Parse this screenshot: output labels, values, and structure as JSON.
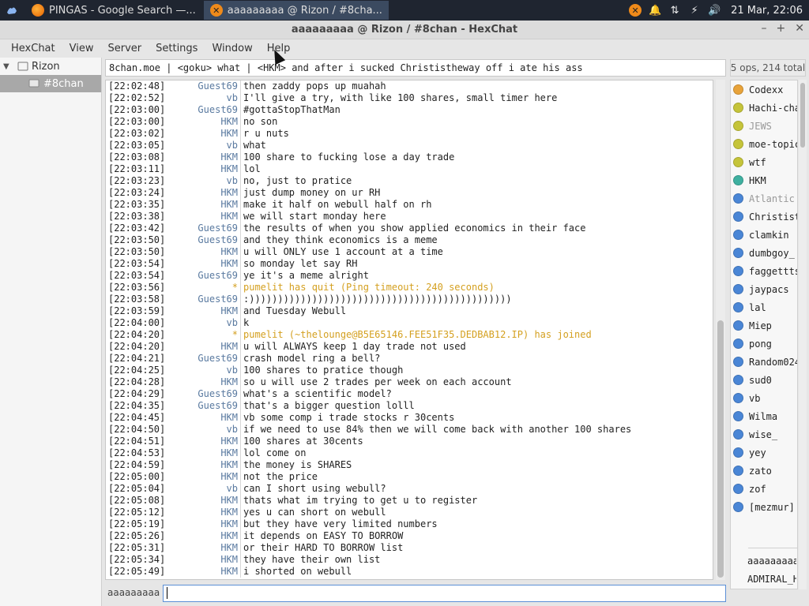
{
  "taskbar": {
    "tasks": [
      {
        "label": "PINGAS - Google Search —...",
        "icon": "firefox-icon",
        "color": "#e66000"
      },
      {
        "label": "aaaaaaaaa @ Rizon / #8cha...",
        "icon": "hexchat-icon",
        "color": "#ef8a1a"
      }
    ],
    "clock": "21 Mar, 22:06"
  },
  "window": {
    "title": "aaaaaaaaa @ Rizon / #8chan - HexChat",
    "controls": [
      "–",
      "+",
      "✕"
    ]
  },
  "menu": [
    "HexChat",
    "View",
    "Server",
    "Settings",
    "Window",
    "Help"
  ],
  "tree": {
    "server": "Rizon",
    "channel": "#8chan"
  },
  "topic": "8chan.moe | <goku> what | <HKM> and after i sucked Christistheway off i ate his ass",
  "ops_summary": "5 ops, 214 total",
  "messages": [
    {
      "ts": "[22:02:48]",
      "nick": "Guest69",
      "msg": "then zaddy pops up muahah"
    },
    {
      "ts": "[22:02:52]",
      "nick": "vb",
      "msg": "I'll give a try, with like 100 shares, small timer here"
    },
    {
      "ts": "[22:03:00]",
      "nick": "Guest69",
      "msg": "#gottaStopThatMan"
    },
    {
      "ts": "[22:03:00]",
      "nick": "HKM",
      "msg": "no son"
    },
    {
      "ts": "[22:03:02]",
      "nick": "HKM",
      "msg": "r u nuts"
    },
    {
      "ts": "[22:03:05]",
      "nick": "vb",
      "msg": "what"
    },
    {
      "ts": "[22:03:08]",
      "nick": "HKM",
      "msg": "100 share to fucking lose a day trade"
    },
    {
      "ts": "[22:03:11]",
      "nick": "HKM",
      "msg": "lol"
    },
    {
      "ts": "[22:03:23]",
      "nick": "vb",
      "msg": "no, just to pratice"
    },
    {
      "ts": "[22:03:24]",
      "nick": "HKM",
      "msg": "just dump money on ur RH"
    },
    {
      "ts": "[22:03:35]",
      "nick": "HKM",
      "msg": "make it half on webull half on rh"
    },
    {
      "ts": "[22:03:38]",
      "nick": "HKM",
      "msg": "we will start monday here"
    },
    {
      "ts": "[22:03:42]",
      "nick": "Guest69",
      "msg": "the results of when you show applied economics in their face"
    },
    {
      "ts": "[22:03:50]",
      "nick": "Guest69",
      "msg": "and they think economics is a meme"
    },
    {
      "ts": "[22:03:50]",
      "nick": "HKM",
      "msg": "u will ONLY use 1 account at a time"
    },
    {
      "ts": "[22:03:54]",
      "nick": "HKM",
      "msg": "so monday let say RH"
    },
    {
      "ts": "[22:03:54]",
      "nick": "Guest69",
      "msg": "ye it's a meme alright"
    },
    {
      "ts": "[22:03:56]",
      "nick": "*",
      "msg": "pumelit has quit (Ping timeout: 240 seconds)",
      "system": true
    },
    {
      "ts": "[22:03:58]",
      "nick": "Guest69",
      "msg": ":))))))))))))))))))))))))))))))))))))))))))))))"
    },
    {
      "ts": "[22:03:59]",
      "nick": "HKM",
      "msg": "and Tuesday Webull"
    },
    {
      "ts": "[22:04:00]",
      "nick": "vb",
      "msg": "k"
    },
    {
      "ts": "[22:04:20]",
      "nick": "*",
      "msg": "pumelit (~thelounge@B5E65146.FEE51F35.DEDBAB12.IP) has joined",
      "system": true
    },
    {
      "ts": "[22:04:20]",
      "nick": "HKM",
      "msg": "u will ALWAYS keep 1 day trade not used"
    },
    {
      "ts": "[22:04:21]",
      "nick": "Guest69",
      "msg": "crash model ring a bell?"
    },
    {
      "ts": "[22:04:25]",
      "nick": "vb",
      "msg": "100 shares to pratice though"
    },
    {
      "ts": "[22:04:28]",
      "nick": "HKM",
      "msg": "so u will use 2 trades per week on each account"
    },
    {
      "ts": "[22:04:29]",
      "nick": "Guest69",
      "msg": "what's a scientific model?"
    },
    {
      "ts": "[22:04:35]",
      "nick": "Guest69",
      "msg": "that's a bigger question lolll"
    },
    {
      "ts": "[22:04:45]",
      "nick": "HKM",
      "msg": "vb some comp i trade stocks r 30cents"
    },
    {
      "ts": "[22:04:50]",
      "nick": "vb",
      "msg": "if we need to use 84% then we will come back with another 100 shares"
    },
    {
      "ts": "[22:04:51]",
      "nick": "HKM",
      "msg": "100 shares at 30cents"
    },
    {
      "ts": "[22:04:53]",
      "nick": "HKM",
      "msg": "lol come on"
    },
    {
      "ts": "[22:04:59]",
      "nick": "HKM",
      "msg": "the money is SHARES"
    },
    {
      "ts": "[22:05:00]",
      "nick": "HKM",
      "msg": "not the price"
    },
    {
      "ts": "[22:05:04]",
      "nick": "vb",
      "msg": "can I short using webull?"
    },
    {
      "ts": "[22:05:08]",
      "nick": "HKM",
      "msg": "thats what im trying to get u to register"
    },
    {
      "ts": "[22:05:12]",
      "nick": "HKM",
      "msg": "yes u can short on webull"
    },
    {
      "ts": "[22:05:19]",
      "nick": "HKM",
      "msg": "but they have very limited numbers"
    },
    {
      "ts": "[22:05:26]",
      "nick": "HKM",
      "msg": "it depends on EASY TO BORROW"
    },
    {
      "ts": "[22:05:31]",
      "nick": "HKM",
      "msg": "or their HARD TO BORROW list"
    },
    {
      "ts": "[22:05:34]",
      "nick": "HKM",
      "msg": "they have their own list"
    },
    {
      "ts": "[22:05:49]",
      "nick": "HKM",
      "msg": "i shorted on webull"
    }
  ],
  "users": [
    {
      "name": "Codexx",
      "color": "#e8a33a",
      "away": false
    },
    {
      "name": "Hachi-cha",
      "color": "#c5c43a",
      "away": false
    },
    {
      "name": "JEWS",
      "color": "#c5c43a",
      "away": true
    },
    {
      "name": "moe-topic",
      "color": "#c5c43a",
      "away": false
    },
    {
      "name": "wtf",
      "color": "#c5c43a",
      "away": false
    },
    {
      "name": "HKM",
      "color": "#3fb0a0",
      "away": false
    },
    {
      "name": "Atlantic",
      "color": "#4a86d6",
      "away": true
    },
    {
      "name": "Christist",
      "color": "#4a86d6",
      "away": false
    },
    {
      "name": "clamkin",
      "color": "#4a86d6",
      "away": false
    },
    {
      "name": "dumbgoy_",
      "color": "#4a86d6",
      "away": false
    },
    {
      "name": "faggettts",
      "color": "#4a86d6",
      "away": false
    },
    {
      "name": "jaypacs",
      "color": "#4a86d6",
      "away": false
    },
    {
      "name": "lal",
      "color": "#4a86d6",
      "away": false
    },
    {
      "name": "Miep",
      "color": "#4a86d6",
      "away": false
    },
    {
      "name": "pong",
      "color": "#4a86d6",
      "away": false
    },
    {
      "name": "Random024",
      "color": "#4a86d6",
      "away": false
    },
    {
      "name": "sud0",
      "color": "#4a86d6",
      "away": false
    },
    {
      "name": "vb",
      "color": "#4a86d6",
      "away": false
    },
    {
      "name": "Wilma",
      "color": "#4a86d6",
      "away": false
    },
    {
      "name": "wise_",
      "color": "#4a86d6",
      "away": false
    },
    {
      "name": "yey",
      "color": "#4a86d6",
      "away": false
    },
    {
      "name": "zato",
      "color": "#4a86d6",
      "away": false
    },
    {
      "name": "zof",
      "color": "#4a86d6",
      "away": false
    },
    {
      "name": "[mezmur]",
      "color": "#4a86d6",
      "away": false
    }
  ],
  "userlist_bottom": [
    "aaaaaaaaa",
    "ADMIRAL_H"
  ],
  "input": {
    "nick": "aaaaaaaaa",
    "value": ""
  }
}
